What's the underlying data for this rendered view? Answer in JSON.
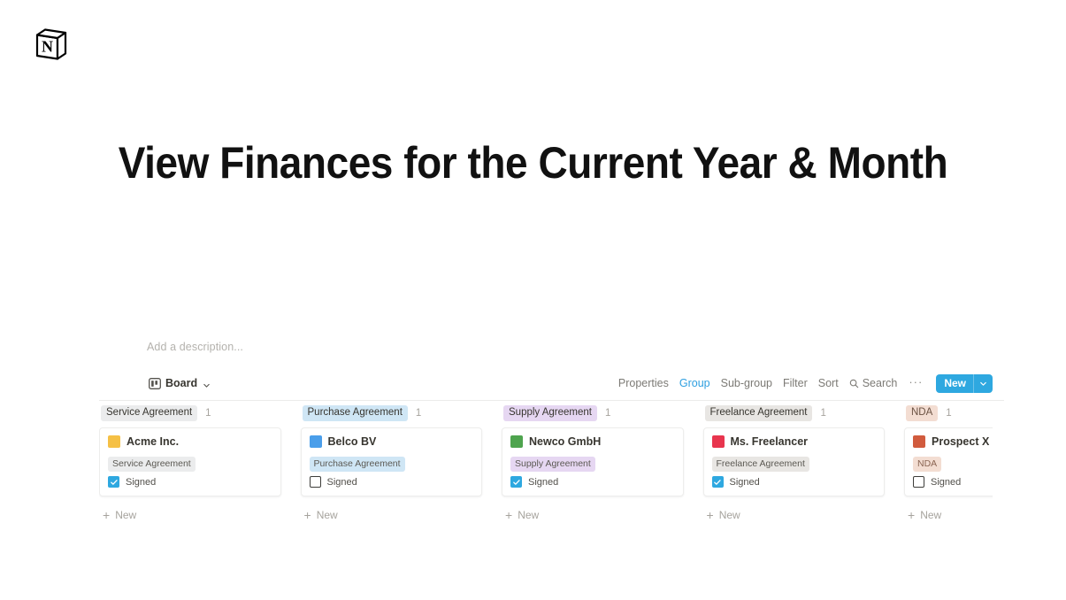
{
  "app": {
    "logo_icon": "notion-cube-logo"
  },
  "page": {
    "title": "View Finances for the Current Year & Month"
  },
  "database": {
    "description_placeholder": "Add a description...",
    "view": {
      "icon": "board-view-icon",
      "label": "Board",
      "chevron_icon": "chevron-down-icon"
    },
    "toolbar": {
      "items": [
        {
          "label": "Properties",
          "active": false
        },
        {
          "label": "Group",
          "active": true
        },
        {
          "label": "Sub-group",
          "active": false
        },
        {
          "label": "Filter",
          "active": false
        },
        {
          "label": "Sort",
          "active": false
        }
      ],
      "search": {
        "label": "Search",
        "icon": "search-icon"
      },
      "more": {
        "label": "···",
        "icon": "ellipsis-icon"
      },
      "new_button": {
        "label": "New",
        "chevron_icon": "chevron-down-icon",
        "color": "#2ea8e0"
      }
    },
    "add_new_label": "New",
    "add_new_icon": "plus-icon",
    "columns": [
      {
        "group_name": "Service Agreement",
        "group_tag_bg": "#ebeced",
        "group_tag_fg": "#37352f",
        "count": "1",
        "card": {
          "swatch_color": "#f5c045",
          "title": "Acme Inc.",
          "tag_label": "Service Agreement",
          "tag_bg": "#ebeced",
          "tag_fg": "#5b5953",
          "checkbox_label": "Signed",
          "checked": true
        }
      },
      {
        "group_name": "Purchase Agreement",
        "group_tag_bg": "#cfe6f5",
        "group_tag_fg": "#37352f",
        "count": "1",
        "card": {
          "swatch_color": "#4a9eea",
          "title": "Belco BV",
          "tag_label": "Purchase Agreement",
          "tag_bg": "#cfe6f5",
          "tag_fg": "#5b5953",
          "checkbox_label": "Signed",
          "checked": false
        }
      },
      {
        "group_name": "Supply Agreement",
        "group_tag_bg": "#e6d7f2",
        "group_tag_fg": "#37352f",
        "count": "1",
        "card": {
          "swatch_color": "#4ea44e",
          "title": "Newco GmbH",
          "tag_label": "Supply Agreement",
          "tag_bg": "#e6d7f2",
          "tag_fg": "#5b5953",
          "checkbox_label": "Signed",
          "checked": true
        }
      },
      {
        "group_name": "Freelance Agreement",
        "group_tag_bg": "#e8e6e3",
        "group_tag_fg": "#37352f",
        "count": "1",
        "card": {
          "swatch_color": "#e8354e",
          "title": "Ms. Freelancer",
          "tag_label": "Freelance Agreement",
          "tag_bg": "#e8e6e3",
          "tag_fg": "#5b5953",
          "checkbox_label": "Signed",
          "checked": true
        }
      },
      {
        "group_name": "NDA",
        "group_tag_bg": "#f3ddd2",
        "group_tag_fg": "#6b5243",
        "count": "1",
        "card": {
          "swatch_color": "#d15b3e",
          "title": "Prospect X",
          "tag_label": "NDA",
          "tag_bg": "#f3ddd2",
          "tag_fg": "#8a6452",
          "checkbox_label": "Signed",
          "checked": false
        }
      }
    ]
  }
}
